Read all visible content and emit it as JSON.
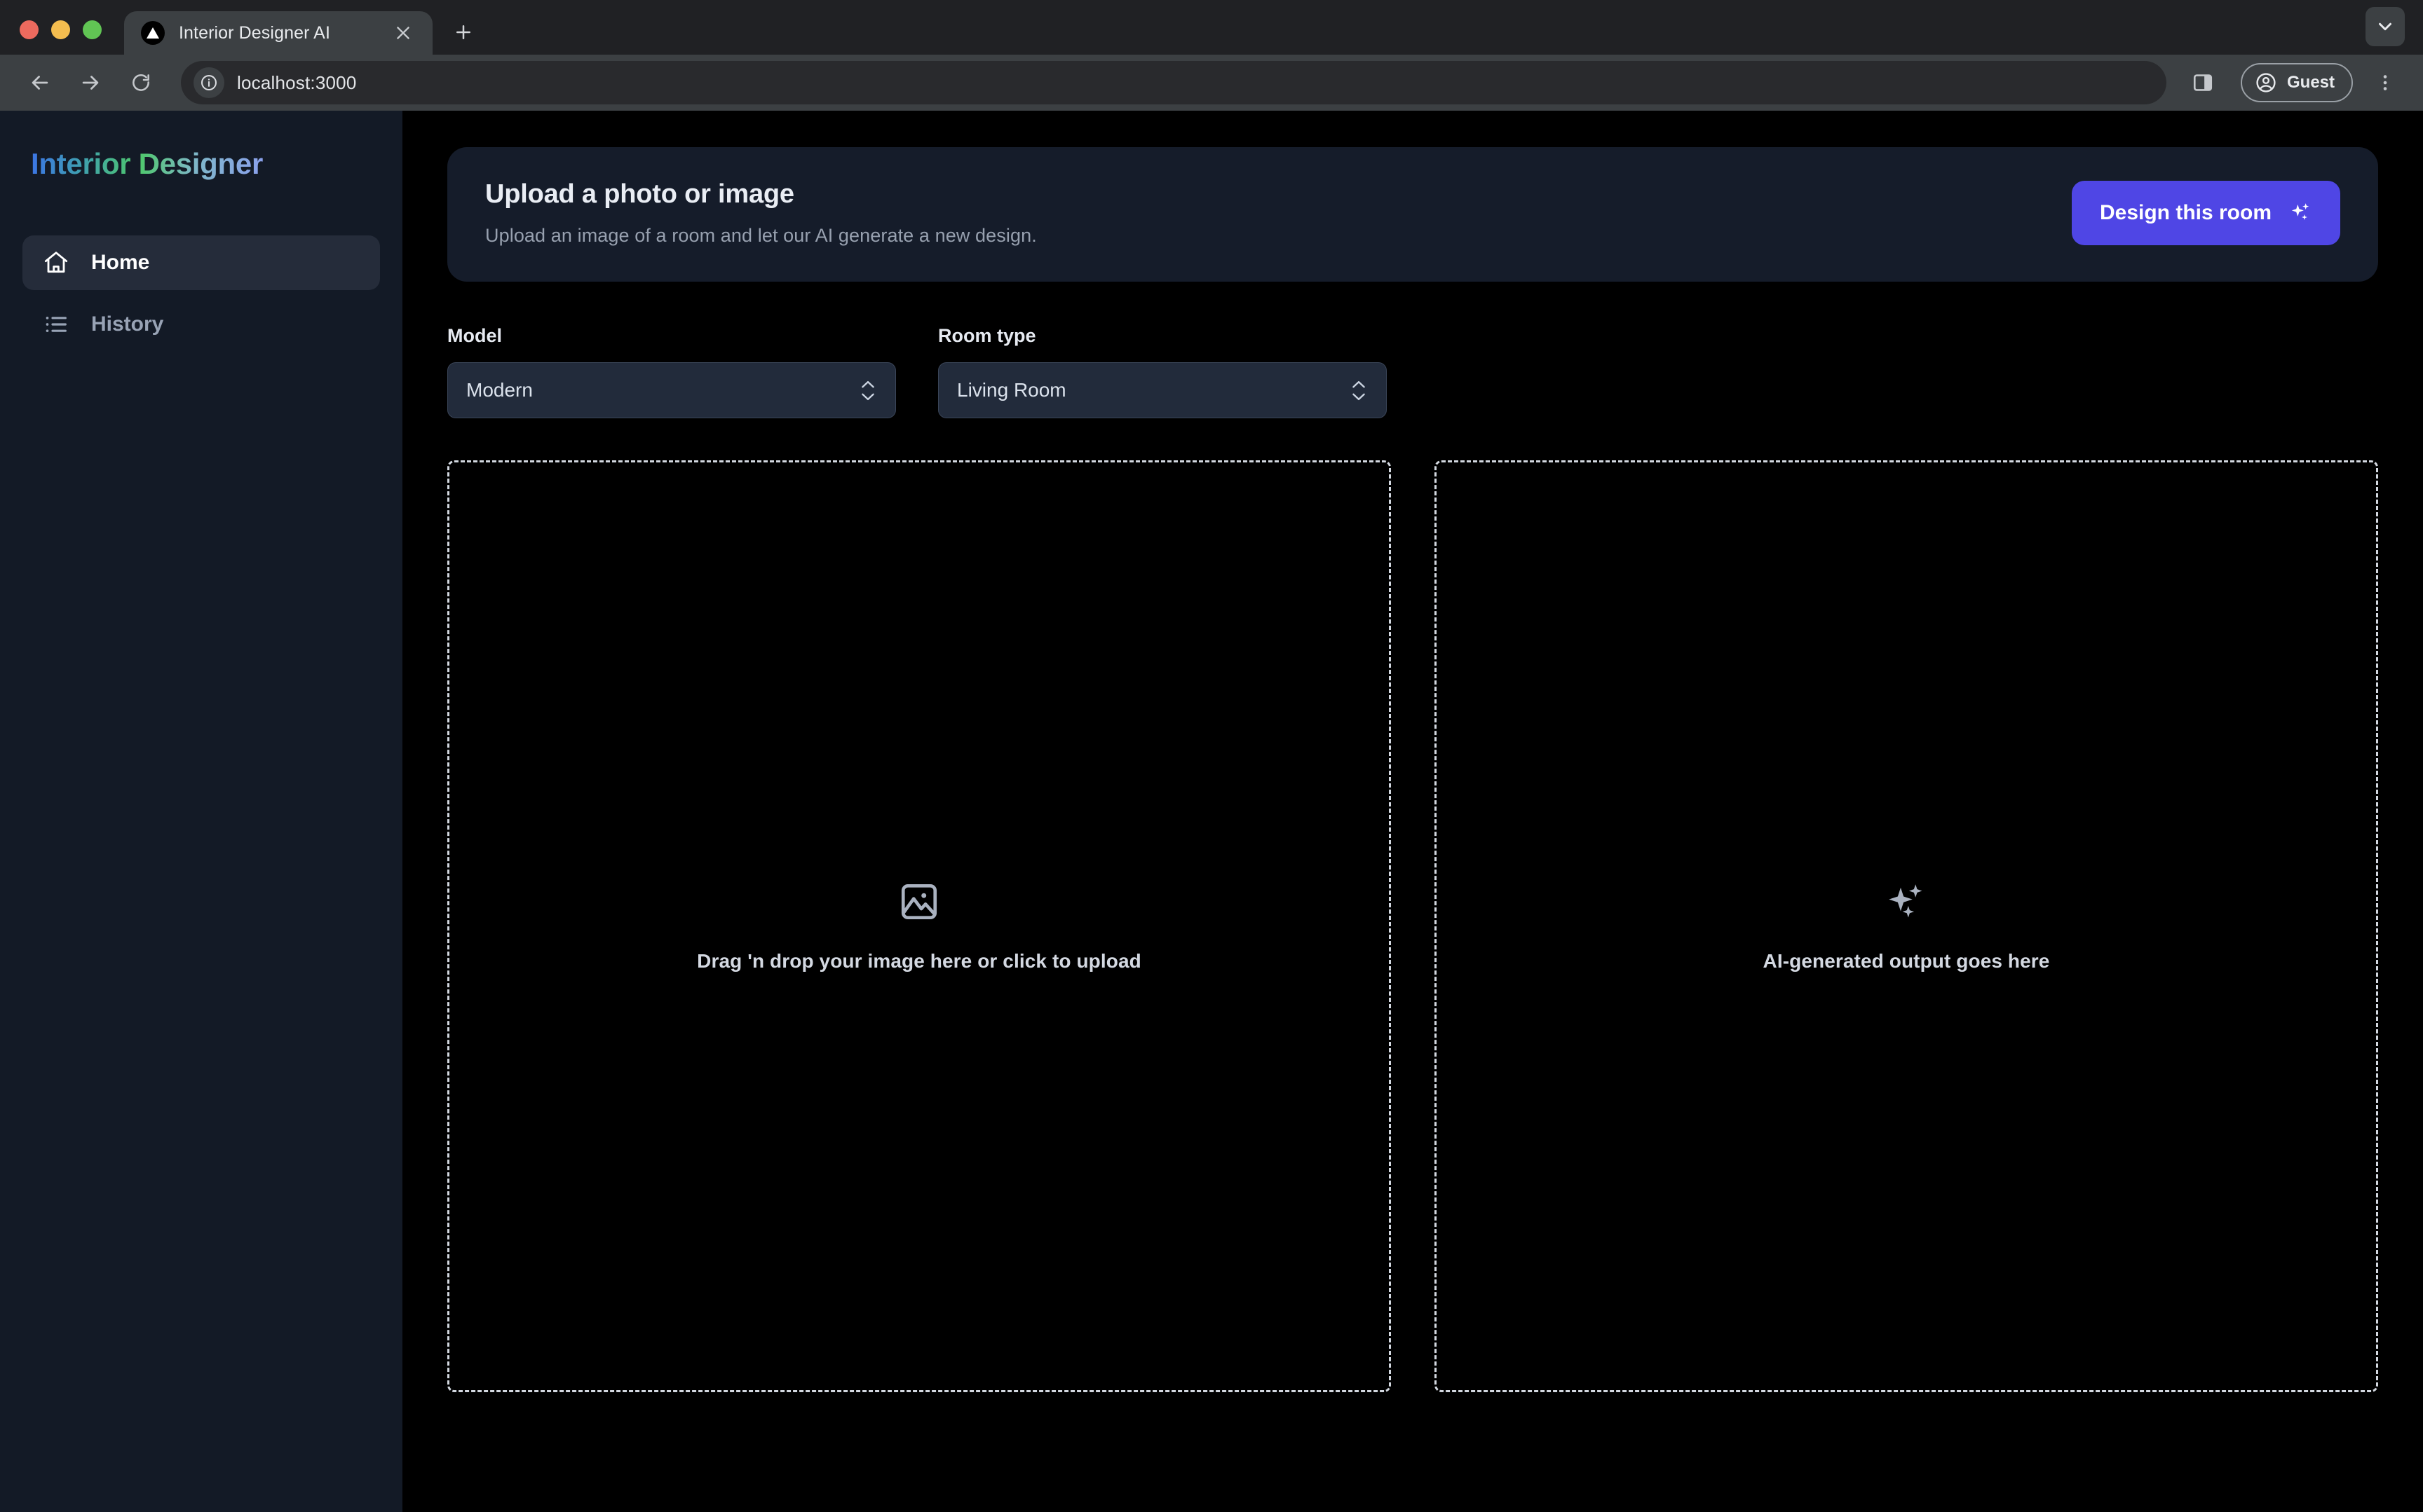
{
  "browser": {
    "tab": {
      "title": "Interior Designer AI",
      "favicon": "vercel-triangle-icon",
      "close_icon": "close-icon"
    },
    "new_tab_icon": "plus-icon",
    "tab_list_icon": "chevron-down-icon",
    "back_icon": "back-arrow-icon",
    "forward_icon": "forward-arrow-icon",
    "reload_icon": "reload-icon",
    "omnibox": {
      "site_info_icon": "info-circle-icon",
      "url": "localhost:3000"
    },
    "side_panel_icon": "side-panel-icon",
    "profile": {
      "label": "Guest",
      "icon": "account-circle-icon"
    },
    "menu_icon": "three-dots-vertical-icon"
  },
  "sidebar": {
    "logo": "Interior Designer",
    "items": [
      {
        "label": "Home",
        "icon": "home-icon",
        "active": true
      },
      {
        "label": "History",
        "icon": "list-icon",
        "active": false
      }
    ]
  },
  "hero": {
    "title": "Upload a photo or image",
    "subtitle": "Upload an image of a room and let our AI generate a new design.",
    "button": {
      "label": "Design this room",
      "icon": "sparkles-icon",
      "color": "#4f46e5"
    }
  },
  "controls": [
    {
      "name": "model",
      "label": "Model",
      "value": "Modern",
      "stepper_icon": "chevron-up-down-icon"
    },
    {
      "name": "room_type",
      "label": "Room type",
      "value": "Living Room",
      "stepper_icon": "chevron-up-down-icon"
    }
  ],
  "panels": {
    "upload": {
      "icon": "image-icon",
      "text": "Drag 'n drop your image here or click to upload"
    },
    "output": {
      "icon": "sparkles-icon",
      "text": "AI-generated output goes here"
    }
  },
  "colors": {
    "accent": "#4f46e5",
    "sidebar_bg": "#131a26",
    "main_bg": "#000000",
    "card_bg": "#151c2a",
    "select_bg": "#222b3b"
  }
}
